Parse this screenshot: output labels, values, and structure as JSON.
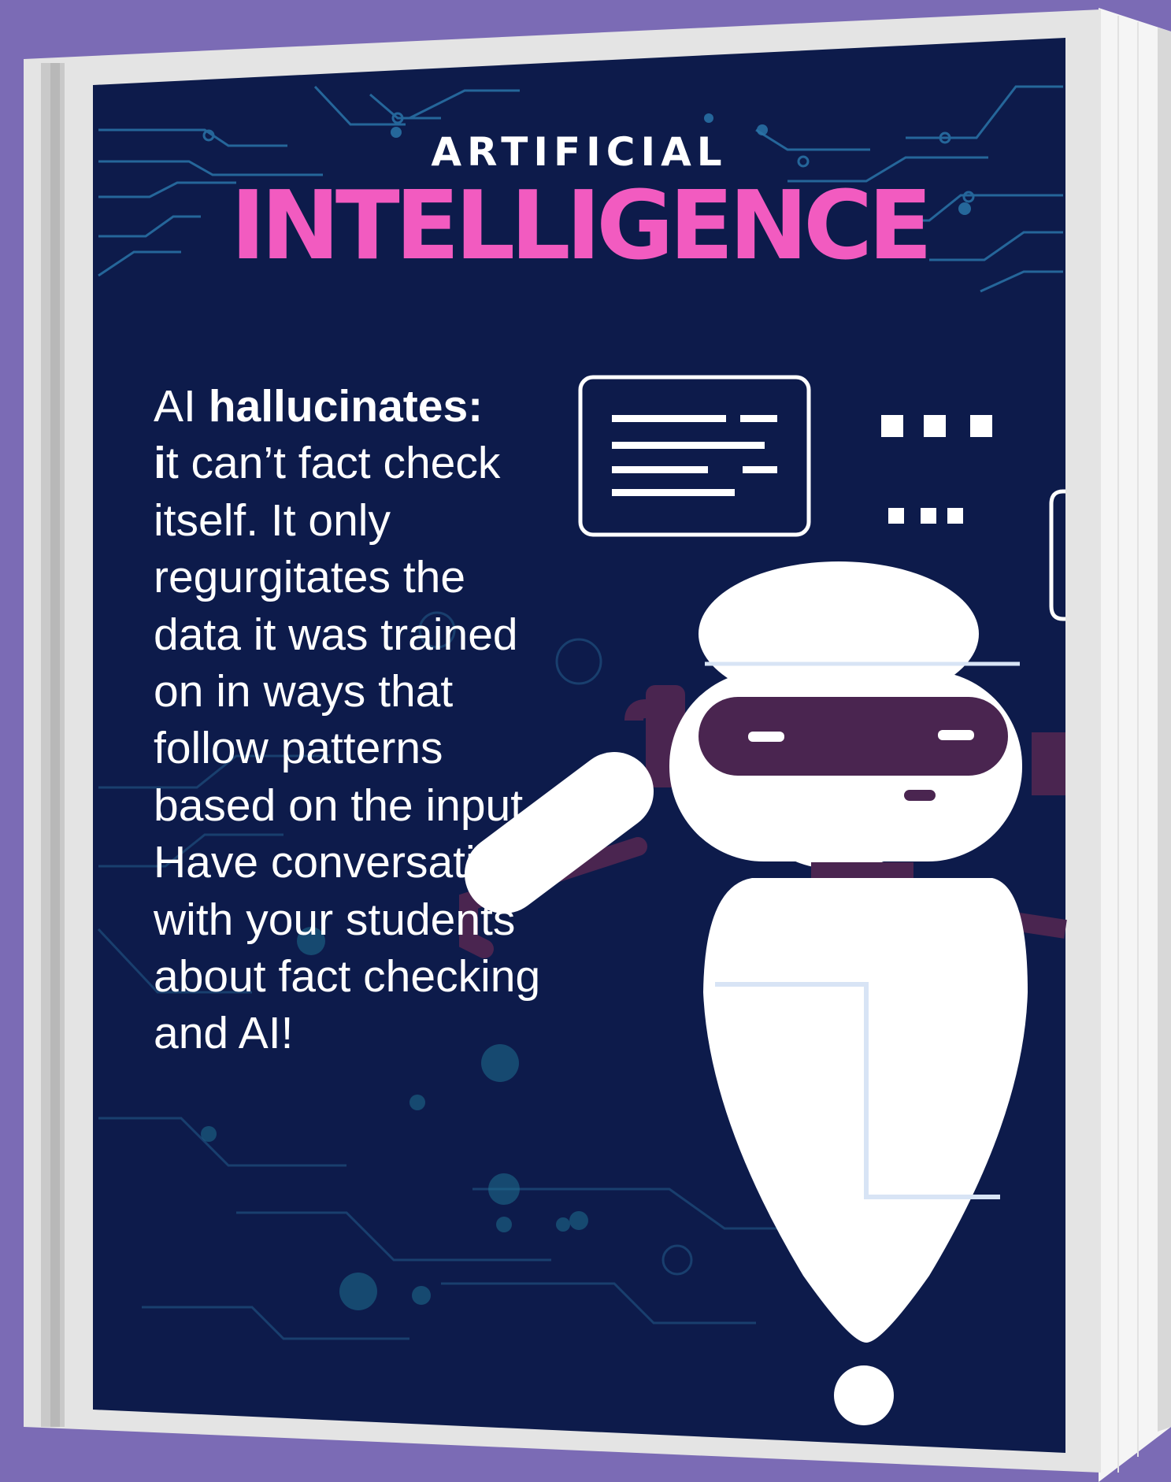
{
  "cover": {
    "title_line1": "ARTIFICIAL",
    "title_line2": "INTELLIGENCE"
  },
  "body": {
    "lead_plain": "AI ",
    "lead_bold": "hallucinates:",
    "bold_initial": "i",
    "after_bold": "t can’t fact check itself.  It only regurgitates the data it was trained on in ways that follow patterns based on the input. Have conversations with your students about fact checking and AI!"
  },
  "colors": {
    "background": "#7b6bb5",
    "cover": "#0d1b4b",
    "title_pink": "#f25bc0",
    "text": "#ffffff",
    "robot_accent": "#4a2550"
  },
  "illustration": {
    "icons": [
      "document-icon",
      "dots-icon",
      "robot-icon",
      "circuit-pattern"
    ]
  }
}
